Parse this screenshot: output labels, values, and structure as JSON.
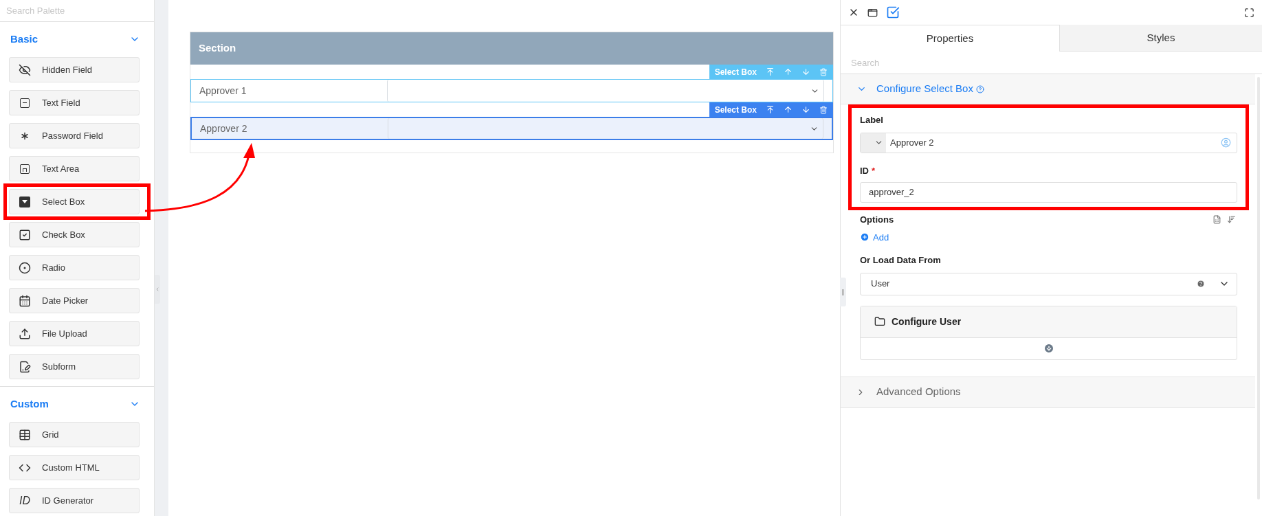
{
  "palette": {
    "search_placeholder": "Search Palette",
    "groups": [
      {
        "title": "Basic",
        "expanded": true,
        "items": [
          {
            "label": "Hidden Field",
            "kind": "hidden",
            "highlighted": false
          },
          {
            "label": "Text Field",
            "kind": "textfield",
            "highlighted": false
          },
          {
            "label": "Password Field",
            "kind": "password",
            "highlighted": false
          },
          {
            "label": "Text Area",
            "kind": "textarea",
            "highlighted": false
          },
          {
            "label": "Select Box",
            "kind": "select",
            "highlighted": true
          },
          {
            "label": "Check Box",
            "kind": "checkbox",
            "highlighted": false
          },
          {
            "label": "Radio",
            "kind": "radio",
            "highlighted": false
          },
          {
            "label": "Date Picker",
            "kind": "date",
            "highlighted": false
          },
          {
            "label": "File Upload",
            "kind": "upload",
            "highlighted": false
          },
          {
            "label": "Subform",
            "kind": "subform",
            "highlighted": false
          }
        ]
      },
      {
        "title": "Custom",
        "expanded": true,
        "items": [
          {
            "label": "Grid",
            "kind": "grid",
            "highlighted": false
          },
          {
            "label": "Custom HTML",
            "kind": "html",
            "highlighted": false
          },
          {
            "label": "ID Generator",
            "kind": "idgen",
            "glyph": "ID",
            "highlighted": false
          }
        ]
      }
    ]
  },
  "canvas": {
    "section_title": "Section",
    "rows": [
      {
        "label": "Approver 1",
        "toolbar_label": "Select Box",
        "selected": false
      },
      {
        "label": "Approver 2",
        "toolbar_label": "Select Box",
        "selected": true
      }
    ]
  },
  "panel": {
    "tabs": [
      {
        "label": "Properties",
        "selected": true
      },
      {
        "label": "Styles",
        "selected": false
      }
    ],
    "search_placeholder": "Search",
    "configure": {
      "title": "Configure Select Box",
      "expanded": true
    },
    "highlighted": true,
    "label_field": {
      "label": "Label",
      "value": "Approver 2"
    },
    "id_field": {
      "label": "ID",
      "required": true,
      "required_mark": "*",
      "value": "approver_2"
    },
    "options": {
      "label": "Options",
      "add": "Add"
    },
    "load_from": {
      "label": "Or Load Data From",
      "value": "User"
    },
    "configure_user": {
      "title": "Configure User"
    },
    "advanced": {
      "title": "Advanced Options",
      "expanded": false
    }
  }
}
